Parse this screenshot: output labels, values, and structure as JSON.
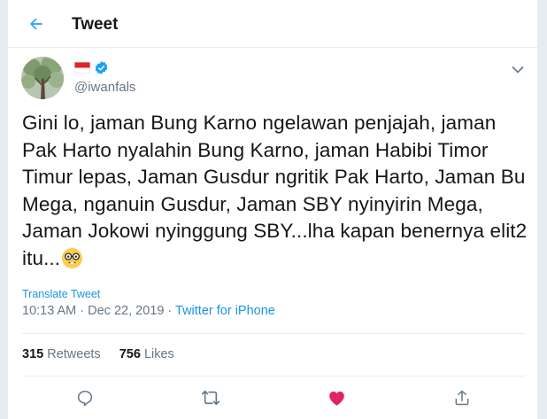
{
  "header": {
    "title": "Tweet",
    "back_icon": "back-arrow-icon"
  },
  "colors": {
    "accent": "#1da1f2",
    "link": "#1b95e0",
    "muted": "#657786",
    "like": "#e0245e"
  },
  "tweet": {
    "handle": "@iwanfals",
    "text_lines": [
      "Gini lo, jaman Bung Karno ngelawan penjajah, jaman",
      "Pak Harto nyalahin Bung Karno, jaman Habibi Timor",
      "Timur lepas, Jaman Gusdur ngritik Pak Harto, Jaman Bu",
      "Mega, nganuin Gusdur, Jaman SBY nyinyirin Mega,",
      "Jaman Jokowi nyinggung SBY...lha kapan benernya elit2",
      "itu..."
    ],
    "emoji": "nerd-face-emoji",
    "translate_label": "Translate Tweet",
    "time": "10:13 AM · Dec 22, 2019 · ",
    "source": "Twitter for iPhone"
  },
  "stats": {
    "retweets_count": "315",
    "retweets_label": "Retweets",
    "likes_count": "756",
    "likes_label": "Likes"
  },
  "actions": [
    "reply-icon",
    "retweet-icon",
    "like-icon",
    "share-icon"
  ]
}
